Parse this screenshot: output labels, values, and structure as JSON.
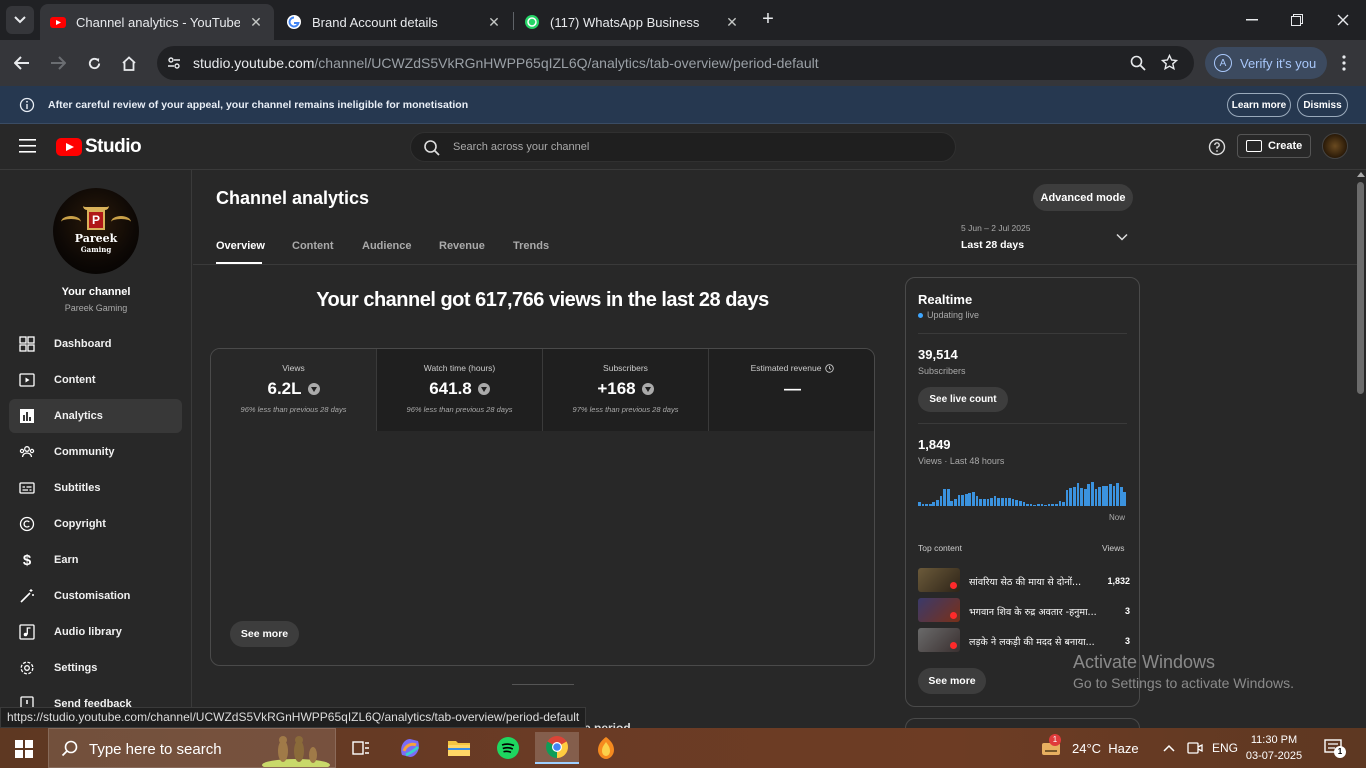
{
  "browser": {
    "tabs": [
      {
        "title": "Channel analytics - YouTube Studio",
        "favicon": "youtube-icon",
        "active": true
      },
      {
        "title": "Brand Account details",
        "favicon": "google-icon",
        "active": false
      },
      {
        "title": "(117) WhatsApp Business",
        "favicon": "whatsapp-icon",
        "active": false
      }
    ],
    "url_host": "studio.youtube.com",
    "url_path": "/channel/UCWZdS5VkRGnHWPP65qIZL6Q/analytics/tab-overview/period-default",
    "verify_label": "Verify it's you",
    "profile_initial": "A",
    "status_url": "https://studio.youtube.com/channel/UCWZdS5VkRGnHWPP65qIZL6Q/analytics/tab-overview/period-default"
  },
  "banner": {
    "text": "After careful review of your appeal, your channel remains ineligible for monetisation",
    "learn_more": "Learn more",
    "dismiss": "Dismiss"
  },
  "header": {
    "logo_text": "Studio",
    "search_placeholder": "Search across your channel",
    "create_label": "Create"
  },
  "sidebar": {
    "avatar_text_1": "Pareek",
    "avatar_text_2": "Gaming",
    "avatar_letter": "P",
    "your_channel": "Your channel",
    "channel_name": "Pareek Gaming",
    "items": [
      {
        "label": "Dashboard",
        "icon": "dashboard-icon"
      },
      {
        "label": "Content",
        "icon": "content-icon"
      },
      {
        "label": "Analytics",
        "icon": "analytics-icon",
        "active": true
      },
      {
        "label": "Community",
        "icon": "community-icon"
      },
      {
        "label": "Subtitles",
        "icon": "subtitles-icon"
      },
      {
        "label": "Copyright",
        "icon": "copyright-icon"
      },
      {
        "label": "Earn",
        "icon": "earn-icon"
      },
      {
        "label": "Customisation",
        "icon": "customisation-icon"
      },
      {
        "label": "Audio library",
        "icon": "audio-library-icon"
      },
      {
        "label": "Settings",
        "icon": "settings-icon"
      },
      {
        "label": "Send feedback",
        "icon": "feedback-icon"
      }
    ]
  },
  "main": {
    "title": "Channel analytics",
    "advanced_mode": "Advanced mode",
    "tabs": [
      "Overview",
      "Content",
      "Audience",
      "Revenue",
      "Trends"
    ],
    "period_dates": "5 Jun – 2 Jul 2025",
    "period_label": "Last 28 days",
    "headline": "Your channel got 617,766 views in the last 28 days",
    "metrics": [
      {
        "label": "Views",
        "value": "6.2L",
        "compare": "96% less than previous 28 days"
      },
      {
        "label": "Watch time (hours)",
        "value": "641.8",
        "compare": "96% less than previous 28 days"
      },
      {
        "label": "Subscribers",
        "value": "+168",
        "compare": "97% less than previous 28 days"
      },
      {
        "label": "Estimated revenue",
        "value": "—",
        "compare": ""
      }
    ],
    "see_more": "See more",
    "hidden_peek": "e period"
  },
  "realtime": {
    "title": "Realtime",
    "status": "Updating live",
    "subscribers_value": "39,514",
    "subscribers_label": "Subscribers",
    "see_live_count": "See live count",
    "views_value": "1,849",
    "views_label": "Views · Last 48 hours",
    "now_label": "Now",
    "bar_values": [
      3,
      2,
      2,
      2,
      3,
      5,
      8,
      14,
      14,
      4,
      6,
      9,
      9,
      10,
      11,
      12,
      8,
      6,
      6,
      6,
      7,
      8,
      7,
      7,
      7,
      7,
      6,
      5,
      4,
      3,
      2,
      2,
      1,
      2,
      2,
      1,
      2,
      2,
      2,
      4,
      3,
      13,
      15,
      16,
      19,
      15,
      14,
      18,
      20,
      14,
      16,
      17,
      17,
      18,
      17,
      19,
      16,
      12
    ],
    "bar_max": 20,
    "top_content_label": "Top content",
    "views_col_label": "Views",
    "top_content": [
      {
        "title": "सांवरिया सेठ की माया से दोनों...",
        "views": "1,832"
      },
      {
        "title": "भगवान शिव के रुद्र अवतार -हनुमा...",
        "views": "3"
      },
      {
        "title": "लड़के ने लकड़ी की मदद से बनाया...",
        "views": "3"
      }
    ],
    "see_more": "See more"
  },
  "watermark": {
    "line1": "Activate Windows",
    "line2": "Go to Settings to activate Windows."
  },
  "taskbar": {
    "search_placeholder": "Type here to search",
    "weather": "24°C  Haze",
    "weather_badge": "1",
    "language": "ENG",
    "time": "11:30 PM",
    "date": "03-07-2025",
    "notification_count": "1"
  }
}
